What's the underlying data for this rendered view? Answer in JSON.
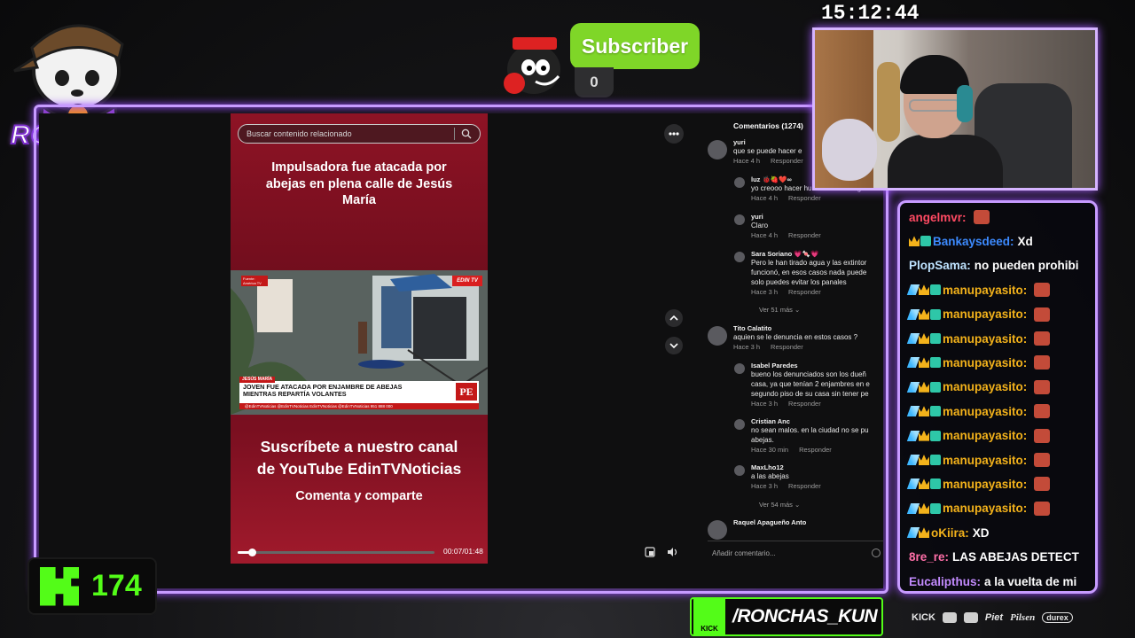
{
  "overlay": {
    "clock": "15:12:44",
    "subscriber_label": "Subscriber",
    "subscriber_count": "0",
    "logo_text": "RONCHAS",
    "kick_viewers": "174",
    "kick_handle": "/RONCHAS_KUN",
    "kick_small": "KICK",
    "sponsors": [
      "KICK",
      "Piet",
      "Pilsen",
      "durex"
    ]
  },
  "browser": {
    "search_placeholder": "Buscar contenido relacionado",
    "video": {
      "title": "Impulsadora fue atacada por abejas en plena calle de Jesús María",
      "source_badge": "Fuente: América TV",
      "channel_badge": "EDIN TV",
      "location_tag": "JESÚS MARÍA",
      "headline_line1": "JOVEN FUE ATACADA POR ENJAMBRE DE ABEJAS",
      "headline_line2": "MIENTRAS REPARTÍA VOLANTES",
      "bug": "PE",
      "ticker": "@EdinTVNoticias   @EdinTVNoticias   EdinTVNoticias   @EdinTVNoticias   951 888 000",
      "cta_line1": "Suscríbete a nuestro canal",
      "cta_line2": "de YouTube EdinTVNoticias",
      "cta_line3": "Comenta y comparte",
      "progress": 0.07,
      "time": "00:07/01:48"
    },
    "comments": {
      "header": "Comentarios (1274)",
      "input_placeholder": "Añadir comentario...",
      "reply_label": "Responder",
      "items": [
        {
          "name": "yuri",
          "text": [
            "que se puede hacer e"
          ],
          "time": "Hace 4 h",
          "level": 0
        },
        {
          "name": "luz 🐞🍓❤️∞",
          "text": [
            "yo creooo hacer humear kemar algo"
          ],
          "time": "Hace 4 h",
          "level": 1
        },
        {
          "name": "yuri",
          "text": [
            "Claro"
          ],
          "time": "Hace 4 h",
          "level": 1
        },
        {
          "name": "Sara Soriano 💗🍬💗",
          "text": [
            "Pero le han tirado agua y las extintor",
            "funcionó, en esos casos nada puede",
            "solo puedes evitar los panales"
          ],
          "time": "Hace 3 h",
          "level": 1
        },
        {
          "name": "Tito Calatito",
          "text": [
            "aquien se le denuncia en estos casos ?"
          ],
          "time": "Hace 3 h",
          "level": 0
        },
        {
          "name": "Isabel Paredes",
          "text": [
            "bueno los denunciados son los dueñ",
            "casa, ya que tenían 2 enjambres en e",
            "segundo piso de su casa sin tener pe"
          ],
          "time": "Hace 3 h",
          "level": 1
        },
        {
          "name": "Cristian Anc",
          "text": [
            "no sean malos. en la ciudad no se pu",
            "abejas."
          ],
          "time": "Hace 30 min",
          "level": 1
        },
        {
          "name": "MaxLho12",
          "text": [
            "a las abejas"
          ],
          "time": "Hace 3 h",
          "level": 1
        },
        {
          "name": "Raquel Apagueño Anto",
          "text": [
            ""
          ],
          "time": "",
          "level": 0
        }
      ],
      "more_1": "Ver 51 más ⌄",
      "more_2": "Ver 54 más ⌄"
    }
  },
  "chat": {
    "messages": [
      {
        "user": "angelmvr:",
        "msg": "",
        "color": "#ff4a63",
        "badges": [],
        "emote": true
      },
      {
        "user": "Bankaysdeed:",
        "msg": "Xd",
        "color": "#3d8bff",
        "badges": [
          "crown",
          "gift"
        ],
        "emote": false
      },
      {
        "user": "PlopSama:",
        "msg": "no pueden prohibi",
        "color": "#bfe3ff",
        "badges": [],
        "emote": false
      },
      {
        "user": "manupayasito:",
        "msg": "",
        "color": "#f3b21b",
        "badges": [
          "pick",
          "crown",
          "gift"
        ],
        "emote": true
      },
      {
        "user": "manupayasito:",
        "msg": "",
        "color": "#f3b21b",
        "badges": [
          "pick",
          "crown",
          "gift"
        ],
        "emote": true
      },
      {
        "user": "manupayasito:",
        "msg": "",
        "color": "#f3b21b",
        "badges": [
          "pick",
          "crown",
          "gift"
        ],
        "emote": true
      },
      {
        "user": "manupayasito:",
        "msg": "",
        "color": "#f3b21b",
        "badges": [
          "pick",
          "crown",
          "gift"
        ],
        "emote": true
      },
      {
        "user": "manupayasito:",
        "msg": "",
        "color": "#f3b21b",
        "badges": [
          "pick",
          "crown",
          "gift"
        ],
        "emote": true
      },
      {
        "user": "manupayasito:",
        "msg": "",
        "color": "#f3b21b",
        "badges": [
          "pick",
          "crown",
          "gift"
        ],
        "emote": true
      },
      {
        "user": "manupayasito:",
        "msg": "",
        "color": "#f3b21b",
        "badges": [
          "pick",
          "crown",
          "gift"
        ],
        "emote": true
      },
      {
        "user": "manupayasito:",
        "msg": "",
        "color": "#f3b21b",
        "badges": [
          "pick",
          "crown",
          "gift"
        ],
        "emote": true
      },
      {
        "user": "manupayasito:",
        "msg": "",
        "color": "#f3b21b",
        "badges": [
          "pick",
          "crown",
          "gift"
        ],
        "emote": true
      },
      {
        "user": "manupayasito:",
        "msg": "",
        "color": "#f3b21b",
        "badges": [
          "pick",
          "crown",
          "gift"
        ],
        "emote": true
      },
      {
        "user": "oKiira:",
        "msg": "XD",
        "color": "#f3b21b",
        "badges": [
          "pick",
          "crown"
        ],
        "emote": false
      },
      {
        "user": "8re_re:",
        "msg": "LAS ABEJAS DETECT",
        "color": "#ff6fa8",
        "badges": [],
        "emote": false
      },
      {
        "user": "Eucalipthus:",
        "msg": "a la vuelta de mi",
        "color": "#c38bff",
        "badges": [],
        "emote": false
      }
    ]
  }
}
